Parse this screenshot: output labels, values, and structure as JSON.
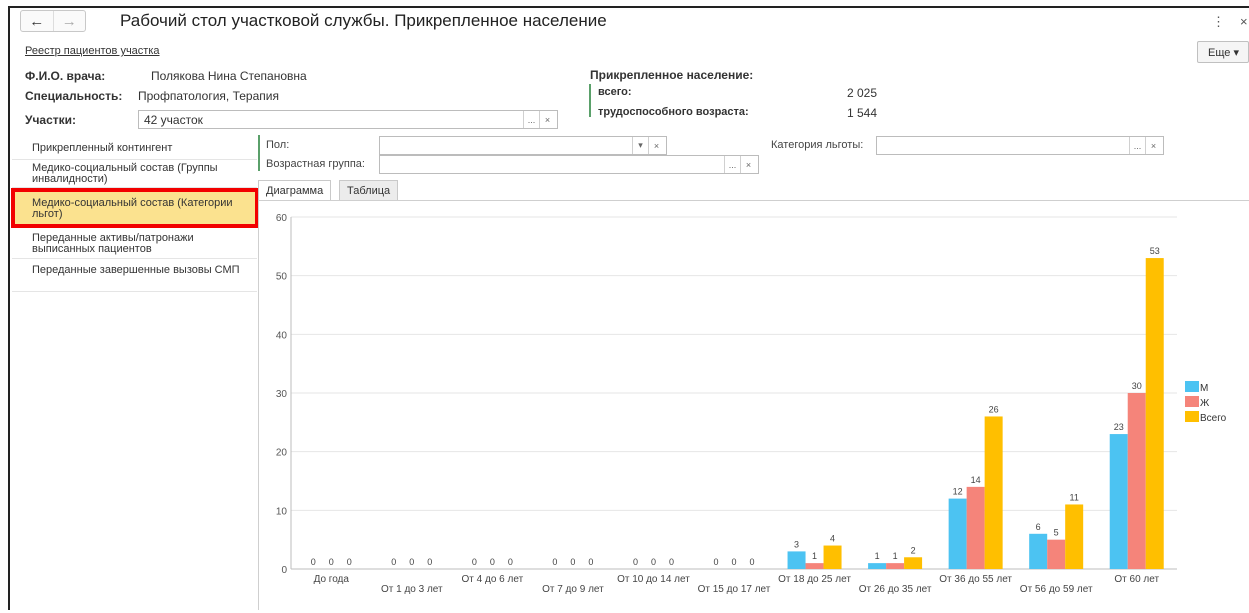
{
  "window": {
    "title": "Рабочий стол участковой службы. Прикрепленное население",
    "nav_back": "←",
    "nav_forward": "→",
    "menu_glyph": "⋮",
    "close_glyph": "×"
  },
  "header": {
    "registry_link": "Реестр пациентов участка",
    "more_button": "Еще ▾"
  },
  "doctor": {
    "name_label": "Ф.И.О. врача:",
    "name_value": "Полякова Нина Степановна",
    "specialty_label": "Специальность:",
    "specialty_value": "Профпатология, Терапия",
    "districts_label": "Участки:",
    "districts_value": "42 участок"
  },
  "population": {
    "heading": "Прикрепленное население:",
    "total_label": "всего:",
    "total_value": "2 025",
    "working_age_label": "трудоспособного возраста:",
    "working_age_value": "1 544"
  },
  "sidebar": {
    "items": [
      {
        "label": "Прикрепленный контингент"
      },
      {
        "label": "Медико-социальный состав (Группы инвалидности)"
      },
      {
        "label": "Медико-социальный состав (Категории льгот)"
      },
      {
        "label": "Переданные активы/патронажи выписанных пациентов"
      },
      {
        "label": "Переданные завершенные вызовы СМП"
      }
    ]
  },
  "filters": {
    "sex_label": "Пол:",
    "sex_value": "",
    "age_group_label": "Возрастная группа:",
    "age_group_value": "",
    "benefit_label": "Категория льготы:",
    "benefit_value": ""
  },
  "tabs": [
    {
      "label": "Диаграмма"
    },
    {
      "label": "Таблица"
    }
  ],
  "chart_data": {
    "type": "bar",
    "categories": [
      "До года",
      "От 1 до 3 лет",
      "От 4 до 6 лет",
      "От 7 до 9 лет",
      "От 10 до 14 лет",
      "От 15 до 17 лет",
      "От 18 до 25 лет",
      "От 26 до 35 лет",
      "От 36 до 55 лет",
      "От 56 до 59 лет",
      "От 60 лет"
    ],
    "series": [
      {
        "name": "М",
        "color": "#4cc3f2",
        "values": [
          0,
          0,
          0,
          0,
          0,
          0,
          3,
          1,
          12,
          6,
          23
        ]
      },
      {
        "name": "Ж",
        "color": "#f5847a",
        "values": [
          0,
          0,
          0,
          0,
          0,
          0,
          1,
          1,
          14,
          5,
          30
        ]
      },
      {
        "name": "Всего",
        "color": "#ffbf00",
        "values": [
          0,
          0,
          0,
          0,
          0,
          0,
          4,
          2,
          26,
          11,
          53
        ]
      }
    ],
    "yticks": [
      0,
      10,
      20,
      30,
      40,
      50,
      60
    ],
    "ylim": [
      0,
      60
    ],
    "grid": true,
    "legend": "right"
  }
}
